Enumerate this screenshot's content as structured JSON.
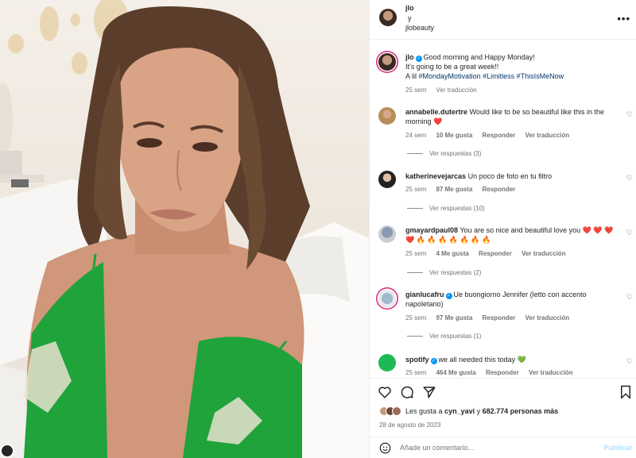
{
  "post": {
    "owner": "jlo",
    "conjunction": "y",
    "collaborator": "jlobeauty",
    "more_icon": "more-horizontal-icon"
  },
  "caption": {
    "username": "jlo",
    "line1": "Good morning and Happy Monday!",
    "line2": "It's going to be a great week!!",
    "line3_prefix": "A lil",
    "hashtags": [
      "#MondayMotivation",
      "#Limitless",
      "#ThisIsMeNow"
    ],
    "time": "25 sem",
    "translate": "Ver traducción"
  },
  "comments": [
    {
      "username": "annabelle.dutertre",
      "text": "Would like to be so beautiful like this in the morning ❤️",
      "time": "24 sem",
      "likes": "10 Me gusta",
      "reply": "Responder",
      "translate": "Ver traducción",
      "replies": "Ver respuestas (3)"
    },
    {
      "username": "katherinevejarcas",
      "text": "Un poco de foto en tu filtro",
      "time": "25 sem",
      "likes": "87 Me gusta",
      "reply": "Responder",
      "translate": "",
      "replies": "Ver respuestas (10)"
    },
    {
      "username": "gmayardpaul08",
      "text": "You are so nice and beautiful love you ❤️ ❤️ ❤️ ❤️ 🔥 🔥 🔥 🔥 🔥 🔥 🔥",
      "time": "25 sem",
      "likes": "4 Me gusta",
      "reply": "Responder",
      "translate": "Ver traducción",
      "replies": "Ver respuestas (2)"
    },
    {
      "username": "gianlucafru",
      "text": "Ue buongiorno Jennifer (letto con accento napoletano)",
      "time": "25 sem",
      "likes": "97 Me gusta",
      "reply": "Responder",
      "translate": "Ver traducción",
      "replies": "Ver respuestas (1)"
    },
    {
      "username": "spotify",
      "text": "we all needed this today 💚",
      "time": "25 sem",
      "likes": "464 Me gusta",
      "reply": "Responder",
      "translate": "Ver traducción",
      "replies": ""
    }
  ],
  "likes": {
    "prefix": "Les gusta a",
    "user": "cyn_yavi",
    "joiner": "y",
    "count": "682.774 personas más"
  },
  "date": "28 de agosto de 2023",
  "add_comment": {
    "placeholder": "Añade un comentario...",
    "publish": "Publicar"
  },
  "colors": {
    "accent": "#0095f6",
    "hashtag": "#00376b",
    "muted": "#737373",
    "heart": "#ed4956",
    "spotify": "#1db954",
    "dress": "#1fa33a"
  }
}
